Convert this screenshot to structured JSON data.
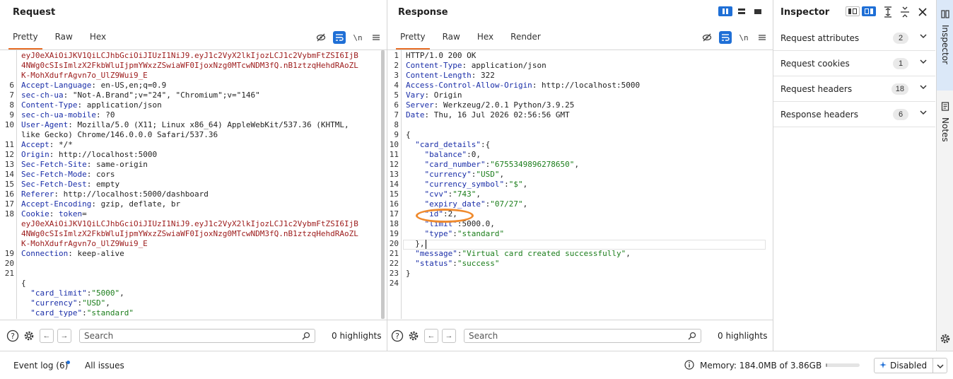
{
  "request": {
    "title": "Request",
    "tabs": [
      "Pretty",
      "Raw",
      "Hex"
    ],
    "active_tab": "Pretty",
    "newline_toggle": "\\n",
    "lines": [
      {
        "n": "",
        "parts": [
          {
            "t": "eyJ0eXAiOiJKV1QiLCJhbGciOiJIUzI1NiJ9.eyJ1c2VyX2lkIjozLCJ1c2VybmFtZSI6IjB",
            "c": "red"
          }
        ]
      },
      {
        "n": "",
        "parts": [
          {
            "t": "4NWg0cSIsImlzX2FkbWluIjpmYWxzZSwiaWF0IjoxNzg0MTcwNDM3fQ.nB1ztzqHehdRAoZL",
            "c": "red"
          }
        ]
      },
      {
        "n": "",
        "parts": [
          {
            "t": "K-MohXdufrAgvn7o_UlZ9Wui9_E",
            "c": "red"
          }
        ]
      },
      {
        "n": "6",
        "parts": [
          {
            "t": "Accept-Language",
            "c": "hn"
          },
          {
            "t": ": en-US,en;q=0.9",
            "c": "hv"
          }
        ]
      },
      {
        "n": "7",
        "parts": [
          {
            "t": "sec-ch-ua",
            "c": "hn"
          },
          {
            "t": ": \"Not-A.Brand\";v=\"24\", \"Chromium\";v=\"146\"",
            "c": "hv"
          }
        ]
      },
      {
        "n": "8",
        "parts": [
          {
            "t": "Content-Type",
            "c": "hn"
          },
          {
            "t": ": application/json",
            "c": "hv"
          }
        ]
      },
      {
        "n": "9",
        "parts": [
          {
            "t": "sec-ch-ua-mobile",
            "c": "hn"
          },
          {
            "t": ": ?0",
            "c": "hv"
          }
        ]
      },
      {
        "n": "10",
        "parts": [
          {
            "t": "User-Agent",
            "c": "hn"
          },
          {
            "t": ": Mozilla/5.0 (X11; Linux x86_64) AppleWebKit/537.36 (KHTML,",
            "c": "hv"
          }
        ]
      },
      {
        "n": "",
        "parts": [
          {
            "t": "like Gecko) Chrome/146.0.0.0 Safari/537.36",
            "c": "hv"
          }
        ]
      },
      {
        "n": "11",
        "parts": [
          {
            "t": "Accept",
            "c": "hn"
          },
          {
            "t": ": */*",
            "c": "hv"
          }
        ]
      },
      {
        "n": "12",
        "parts": [
          {
            "t": "Origin",
            "c": "hn"
          },
          {
            "t": ": http://localhost:5000",
            "c": "hv"
          }
        ]
      },
      {
        "n": "13",
        "parts": [
          {
            "t": "Sec-Fetch-Site",
            "c": "hn"
          },
          {
            "t": ": same-origin",
            "c": "hv"
          }
        ]
      },
      {
        "n": "14",
        "parts": [
          {
            "t": "Sec-Fetch-Mode",
            "c": "hn"
          },
          {
            "t": ": cors",
            "c": "hv"
          }
        ]
      },
      {
        "n": "15",
        "parts": [
          {
            "t": "Sec-Fetch-Dest",
            "c": "hn"
          },
          {
            "t": ": empty",
            "c": "hv"
          }
        ]
      },
      {
        "n": "16",
        "parts": [
          {
            "t": "Referer",
            "c": "hn"
          },
          {
            "t": ": http://localhost:5000/dashboard",
            "c": "hv"
          }
        ]
      },
      {
        "n": "17",
        "parts": [
          {
            "t": "Accept-Encoding",
            "c": "hn"
          },
          {
            "t": ": gzip, deflate, br",
            "c": "hv"
          }
        ]
      },
      {
        "n": "18",
        "parts": [
          {
            "t": "Cookie",
            "c": "hn"
          },
          {
            "t": ": ",
            "c": "hv"
          },
          {
            "t": "token",
            "c": "hn"
          },
          {
            "t": "=",
            "c": "hv"
          }
        ]
      },
      {
        "n": "",
        "parts": [
          {
            "t": "eyJ0eXAiOiJKV1QiLCJhbGciOiJIUzI1NiJ9.eyJ1c2VyX2lkIjozLCJ1c2VybmFtZSI6IjB",
            "c": "red"
          }
        ]
      },
      {
        "n": "",
        "parts": [
          {
            "t": "4NWg0cSIsImlzX2FkbWluIjpmYWxzZSwiaWF0IjoxNzg0MTcwNDM3fQ.nB1ztzqHehdRAoZL",
            "c": "red"
          }
        ]
      },
      {
        "n": "",
        "parts": [
          {
            "t": "K-MohXdufrAgvn7o_UlZ9Wui9_E",
            "c": "red"
          }
        ]
      },
      {
        "n": "19",
        "parts": [
          {
            "t": "Connection",
            "c": "hn"
          },
          {
            "t": ": keep-alive",
            "c": "hv"
          }
        ]
      },
      {
        "n": "20",
        "parts": []
      },
      {
        "n": "21",
        "parts": []
      },
      {
        "n": "",
        "parts": [
          {
            "t": "{",
            "c": "jp"
          }
        ]
      },
      {
        "n": "",
        "parts": [
          {
            "t": "  \"card_limit\"",
            "c": "jk"
          },
          {
            "t": ":",
            "c": "jp"
          },
          {
            "t": "\"5000\"",
            "c": "js"
          },
          {
            "t": ",",
            "c": "jp"
          }
        ]
      },
      {
        "n": "",
        "parts": [
          {
            "t": "  \"currency\"",
            "c": "jk"
          },
          {
            "t": ":",
            "c": "jp"
          },
          {
            "t": "\"USD\"",
            "c": "js"
          },
          {
            "t": ",",
            "c": "jp"
          }
        ]
      },
      {
        "n": "",
        "parts": [
          {
            "t": "  \"card_type\"",
            "c": "jk"
          },
          {
            "t": ":",
            "c": "jp"
          },
          {
            "t": "\"standard\"",
            "c": "js"
          }
        ]
      },
      {
        "n": "",
        "parts": [
          {
            "t": "}",
            "c": "jp"
          }
        ]
      }
    ],
    "search_placeholder": "Search",
    "highlights": "0 highlights"
  },
  "response": {
    "title": "Response",
    "tabs": [
      "Pretty",
      "Raw",
      "Hex",
      "Render"
    ],
    "active_tab": "Pretty",
    "newline_toggle": "\\n",
    "lines": [
      {
        "n": "1",
        "parts": [
          {
            "t": "HTTP/1.0 200 OK",
            "c": "hv"
          }
        ]
      },
      {
        "n": "2",
        "parts": [
          {
            "t": "Content-Type",
            "c": "hn"
          },
          {
            "t": ": application/json",
            "c": "hv"
          }
        ]
      },
      {
        "n": "3",
        "parts": [
          {
            "t": "Content-Length",
            "c": "hn"
          },
          {
            "t": ": 322",
            "c": "hv"
          }
        ]
      },
      {
        "n": "4",
        "parts": [
          {
            "t": "Access-Control-Allow-Origin",
            "c": "hn"
          },
          {
            "t": ": http://localhost:5000",
            "c": "hv"
          }
        ]
      },
      {
        "n": "5",
        "parts": [
          {
            "t": "Vary",
            "c": "hn"
          },
          {
            "t": ": Origin",
            "c": "hv"
          }
        ]
      },
      {
        "n": "6",
        "parts": [
          {
            "t": "Server",
            "c": "hn"
          },
          {
            "t": ": Werkzeug/2.0.1 Python/3.9.25",
            "c": "hv"
          }
        ]
      },
      {
        "n": "7",
        "parts": [
          {
            "t": "Date",
            "c": "hn"
          },
          {
            "t": ": Thu, 16 Jul 2026 02:56:56 GMT",
            "c": "hv"
          }
        ]
      },
      {
        "n": "8",
        "parts": []
      },
      {
        "n": "9",
        "parts": [
          {
            "t": "{",
            "c": "jp"
          }
        ]
      },
      {
        "n": "10",
        "parts": [
          {
            "t": "  \"card_details\"",
            "c": "jk"
          },
          {
            "t": ":{",
            "c": "jp"
          }
        ]
      },
      {
        "n": "11",
        "parts": [
          {
            "t": "    \"balance\"",
            "c": "jk"
          },
          {
            "t": ":0,",
            "c": "jp"
          }
        ]
      },
      {
        "n": "12",
        "parts": [
          {
            "t": "    \"card_number\"",
            "c": "jk"
          },
          {
            "t": ":",
            "c": "jp"
          },
          {
            "t": "\"6755349896278650\"",
            "c": "js"
          },
          {
            "t": ",",
            "c": "jp"
          }
        ]
      },
      {
        "n": "13",
        "parts": [
          {
            "t": "    \"currency\"",
            "c": "jk"
          },
          {
            "t": ":",
            "c": "jp"
          },
          {
            "t": "\"USD\"",
            "c": "js"
          },
          {
            "t": ",",
            "c": "jp"
          }
        ]
      },
      {
        "n": "14",
        "parts": [
          {
            "t": "    \"currency_symbol\"",
            "c": "jk"
          },
          {
            "t": ":",
            "c": "jp"
          },
          {
            "t": "\"$\"",
            "c": "js"
          },
          {
            "t": ",",
            "c": "jp"
          }
        ]
      },
      {
        "n": "15",
        "parts": [
          {
            "t": "    \"cvv\"",
            "c": "jk"
          },
          {
            "t": ":",
            "c": "jp"
          },
          {
            "t": "\"743\"",
            "c": "js"
          },
          {
            "t": ",",
            "c": "jp"
          }
        ]
      },
      {
        "n": "16",
        "parts": [
          {
            "t": "    \"expiry_date\"",
            "c": "jk"
          },
          {
            "t": ":",
            "c": "jp"
          },
          {
            "t": "\"07/27\"",
            "c": "js"
          },
          {
            "t": ",",
            "c": "jp"
          }
        ]
      },
      {
        "n": "17",
        "parts": [
          {
            "t": "    \"id\"",
            "c": "jk"
          },
          {
            "t": ":2,",
            "c": "jp"
          }
        ]
      },
      {
        "n": "18",
        "parts": [
          {
            "t": "    \"limit\"",
            "c": "jk"
          },
          {
            "t": ":5000.0,",
            "c": "jp"
          }
        ]
      },
      {
        "n": "19",
        "parts": [
          {
            "t": "    \"type\"",
            "c": "jk"
          },
          {
            "t": ":",
            "c": "jp"
          },
          {
            "t": "\"standard\"",
            "c": "js"
          }
        ]
      },
      {
        "n": "20",
        "parts": [
          {
            "t": "  },",
            "c": "jp"
          }
        ]
      },
      {
        "n": "21",
        "parts": [
          {
            "t": "  \"message\"",
            "c": "jk"
          },
          {
            "t": ":",
            "c": "jp"
          },
          {
            "t": "\"Virtual card created successfully\"",
            "c": "js"
          },
          {
            "t": ",",
            "c": "jp"
          }
        ]
      },
      {
        "n": "22",
        "parts": [
          {
            "t": "  \"status\"",
            "c": "jk"
          },
          {
            "t": ":",
            "c": "jp"
          },
          {
            "t": "\"success\"",
            "c": "js"
          }
        ]
      },
      {
        "n": "23",
        "parts": [
          {
            "t": "}",
            "c": "jp"
          }
        ]
      },
      {
        "n": "24",
        "parts": []
      }
    ],
    "search_placeholder": "Search",
    "highlights": "0 highlights"
  },
  "inspector": {
    "title": "Inspector",
    "rows": [
      {
        "label": "Request attributes",
        "count": "2"
      },
      {
        "label": "Request cookies",
        "count": "1"
      },
      {
        "label": "Request headers",
        "count": "18"
      },
      {
        "label": "Response headers",
        "count": "6"
      }
    ]
  },
  "side_tabs": {
    "inspector": "Inspector",
    "notes": "Notes"
  },
  "status": {
    "event_log": "Event log (6)",
    "all_issues": "All issues",
    "memory": "Memory: 184.0MB of 3.86GB",
    "memory_fraction": 0.047,
    "disabled": "Disabled"
  },
  "colors": {
    "accent": "#e8702a",
    "blue": "#1f6fd6",
    "annotation": "#ef8a2d"
  }
}
